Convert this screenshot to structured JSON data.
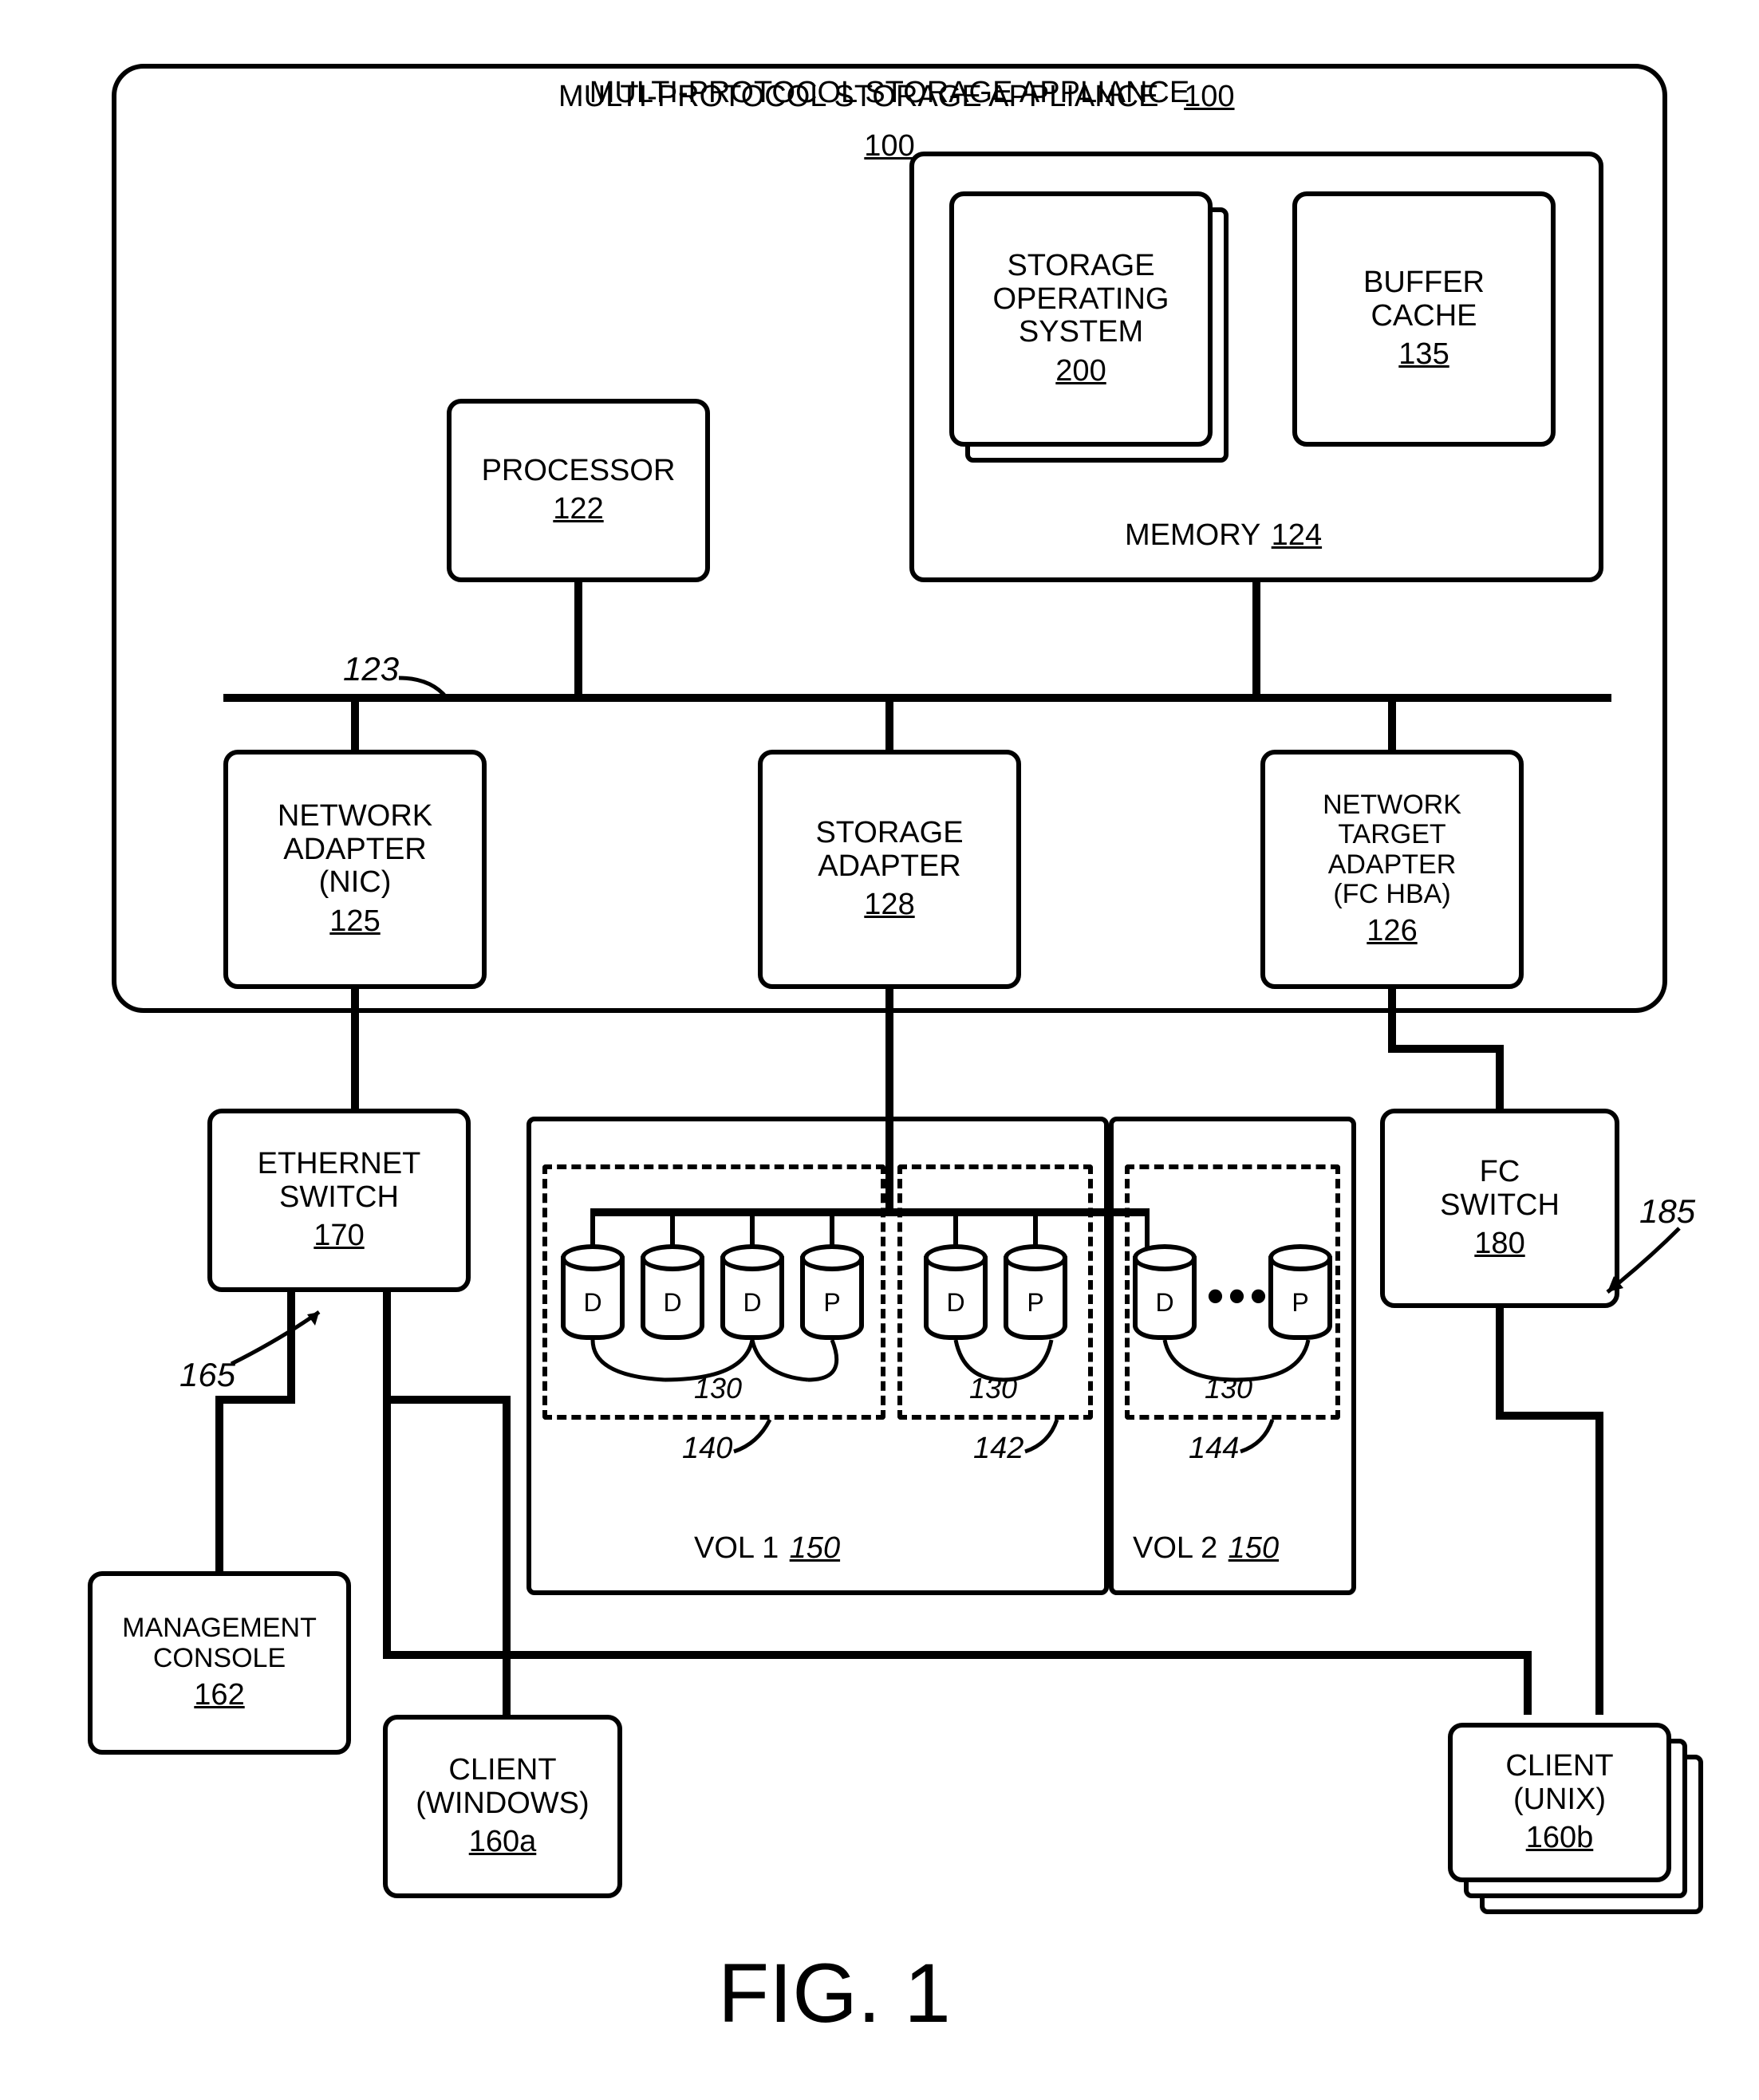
{
  "figure": "FIG. 1",
  "appliance": {
    "title": "MULTI-PROTOCOL STORAGE APPLIANCE",
    "ref": "100"
  },
  "processor": {
    "title": "PROCESSOR",
    "ref": "122"
  },
  "memory": {
    "title": "MEMORY",
    "ref": "124"
  },
  "os": {
    "title": "STORAGE\nOPERATING\nSYSTEM",
    "ref": "200"
  },
  "buffer": {
    "title": "BUFFER\nCACHE",
    "ref": "135"
  },
  "nic": {
    "title": "NETWORK\nADAPTER\n(NIC)",
    "ref": "125"
  },
  "storage_adapter": {
    "title": "STORAGE\nADAPTER",
    "ref": "128"
  },
  "target": {
    "title": "NETWORK\nTARGET\nADAPTER\n(FC HBA)",
    "ref": "126"
  },
  "eth": {
    "title": "ETHERNET\nSWITCH",
    "ref": "170"
  },
  "fc": {
    "title": "FC\nSWITCH",
    "ref": "180"
  },
  "console": {
    "title": "MANAGEMENT\nCONSOLE",
    "ref": "162"
  },
  "client_win": {
    "title": "CLIENT\n(WINDOWS)",
    "ref": "160a"
  },
  "client_unix": {
    "title": "CLIENT\n(UNIX)",
    "ref": "160b"
  },
  "vol1": {
    "label": "VOL 1",
    "ref": "150"
  },
  "vol2": {
    "label": "VOL 2",
    "ref": "150"
  },
  "raid": {
    "g1": "140",
    "g2": "142",
    "g3": "144"
  },
  "disk_ref": "130",
  "bus_ref": "123",
  "net165": "165",
  "net185": "185",
  "D": "D",
  "P": "P"
}
